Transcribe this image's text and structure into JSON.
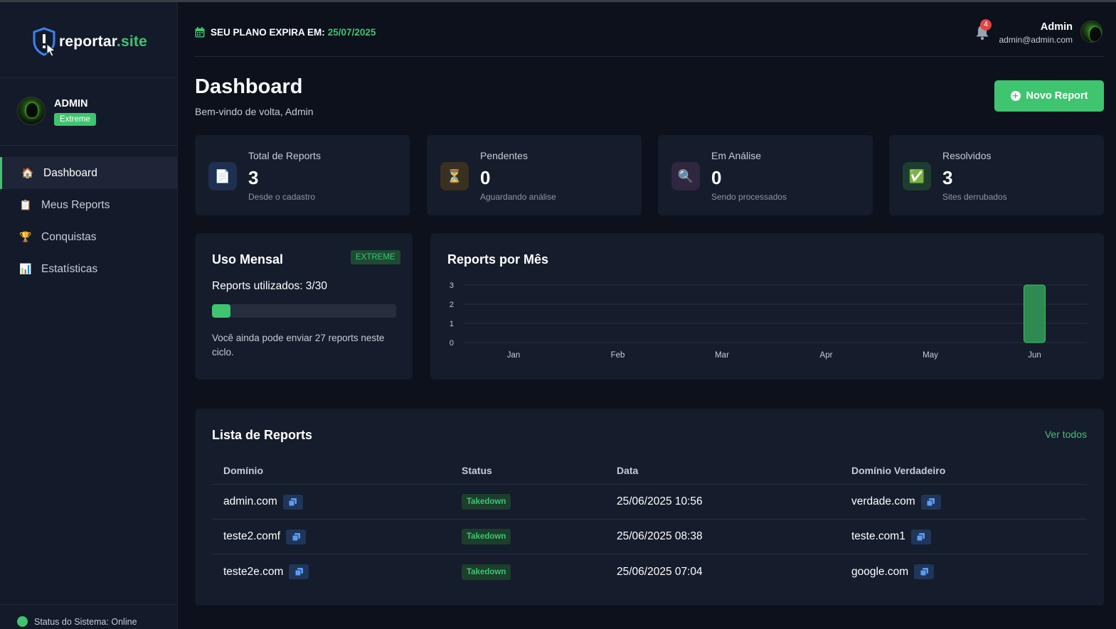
{
  "brand": {
    "name_part1": "reportar",
    "name_part2": ".site"
  },
  "sidebar": {
    "user": {
      "name": "ADMIN",
      "plan_badge": "Extreme"
    },
    "items": [
      {
        "label": "Dashboard",
        "icon": "house-icon",
        "glyph": "🏠",
        "active": true
      },
      {
        "label": "Meus Reports",
        "icon": "clipboard-icon",
        "glyph": "📋",
        "active": false
      },
      {
        "label": "Conquistas",
        "icon": "trophy-icon",
        "glyph": "🏆",
        "active": false
      },
      {
        "label": "Estatísticas",
        "icon": "bar-chart-icon",
        "glyph": "📊",
        "active": false
      }
    ],
    "status": "Status do Sistema: Online"
  },
  "header": {
    "plan_label": "SEU PLANO EXPIRA EM:",
    "plan_date": "25/07/2025",
    "notifications_count": "4",
    "user_name": "Admin",
    "user_email": "admin@admin.com"
  },
  "page": {
    "title": "Dashboard",
    "subtitle": "Bem-vindo de volta, Admin",
    "new_report_label": "Novo Report"
  },
  "stats": [
    {
      "label": "Total de Reports",
      "value": "3",
      "sub": "Desde o cadastro",
      "icon": "document-icon",
      "glyph": "📄",
      "bg": "#1f2f4f"
    },
    {
      "label": "Pendentes",
      "value": "0",
      "sub": "Aguardando análise",
      "icon": "hourglass-icon",
      "glyph": "⏳",
      "bg": "#3a3020"
    },
    {
      "label": "Em Análise",
      "value": "0",
      "sub": "Sendo processados",
      "icon": "magnifier-icon",
      "glyph": "🔍",
      "bg": "#2f2640"
    },
    {
      "label": "Resolvidos",
      "value": "3",
      "sub": "Sites derrubados",
      "icon": "check-icon",
      "glyph": "✅",
      "bg": "#1d3e2f"
    }
  ],
  "usage": {
    "title": "Uso Mensal",
    "badge": "EXTREME",
    "used_text": "Reports utilizados: 3/30",
    "used": 3,
    "limit": 30,
    "note": "Você ainda pode enviar 27 reports neste ciclo."
  },
  "chart_data": {
    "type": "bar",
    "title": "Reports por Mês",
    "categories": [
      "Jan",
      "Feb",
      "Mar",
      "Apr",
      "May",
      "Jun"
    ],
    "values": [
      0,
      0,
      0,
      0,
      0,
      3
    ],
    "yticks": [
      0,
      1,
      2,
      3
    ],
    "ylim": [
      0,
      3
    ],
    "grid": true,
    "legend": "none",
    "color": "#2e8a50"
  },
  "list": {
    "title": "Lista de Reports",
    "link": "Ver todos",
    "columns": [
      "Domínio",
      "Status",
      "Data",
      "Domínio Verdadeiro"
    ],
    "rows": [
      {
        "domain": "admin.com",
        "status": "Takedown",
        "date": "25/06/2025 10:56",
        "true_domain": "verdade.com"
      },
      {
        "domain": "teste2.comf",
        "status": "Takedown",
        "date": "25/06/2025 08:38",
        "true_domain": "teste.com1"
      },
      {
        "domain": "teste2e.com",
        "status": "Takedown",
        "date": "25/06/2025 07:04",
        "true_domain": "google.com"
      }
    ]
  },
  "colors": {
    "accent": "#3fc46f",
    "background": "#0c111c",
    "card": "#151c2b",
    "danger": "#e2473f"
  }
}
